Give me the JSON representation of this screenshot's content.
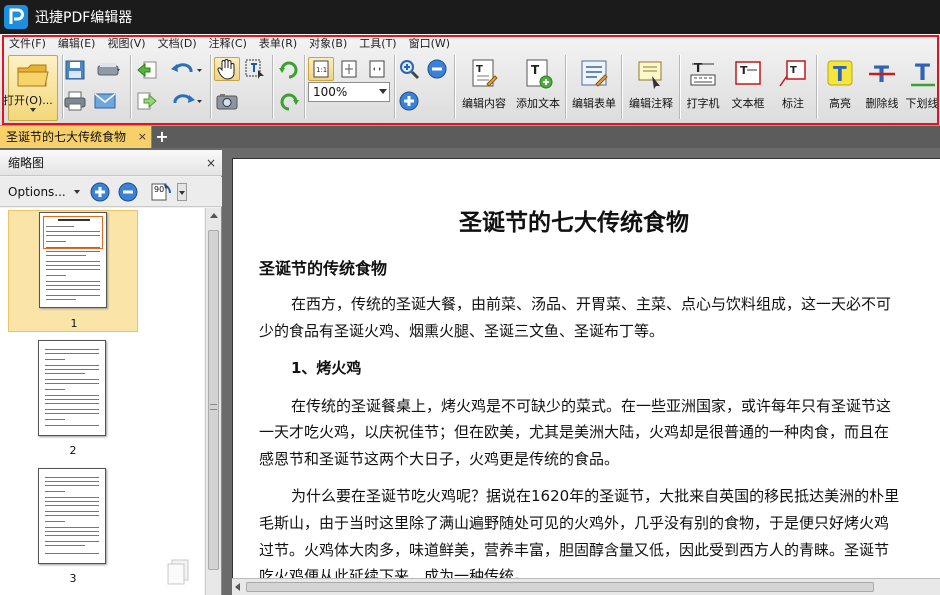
{
  "app": {
    "title": "迅捷PDF编辑器"
  },
  "menu": [
    "文件(F)",
    "编辑(E)",
    "视图(V)",
    "文档(D)",
    "注释(C)",
    "表单(R)",
    "对象(B)",
    "工具(T)",
    "窗口(W)"
  ],
  "toolbar": {
    "open_label": "打开(O)...",
    "zoom_value": "100%",
    "edit_content": "编辑内容",
    "add_text": "添加文本",
    "edit_form": "编辑表单",
    "edit_annotation": "编辑注释",
    "typewriter": "打字机",
    "textbox": "文本框",
    "callout": "标注",
    "highlight": "高亮",
    "strikethrough": "删除线",
    "underline": "下划线"
  },
  "tabs": {
    "doc_tab": "圣诞节的七大传统食物",
    "close": "×",
    "add": "+"
  },
  "left_panel": {
    "title": "缩略图",
    "close": "×",
    "options_label": "Options...",
    "rotate_label": "90°",
    "pages": [
      "1",
      "2",
      "3"
    ]
  },
  "document": {
    "title": "圣诞节的七大传统食物",
    "heading1": "圣诞节的传统食物",
    "p1_l1": "在西方，传统的圣诞大餐，由前菜、汤品、开胃菜、主菜、点心与饮料组成，这一天必不可",
    "p1_l2": "少的食品有圣诞火鸡、烟熏火腿、圣诞三文鱼、圣诞布丁等。",
    "heading2": "1、烤火鸡",
    "p2_l1": "在传统的圣诞餐桌上，烤火鸡是不可缺少的菜式。在一些亚洲国家，或许每年只有圣诞节这",
    "p2_l2": "一天才吃火鸡，以庆祝佳节；但在欧美，尤其是美洲大陆，火鸡却是很普通的一种肉食，而且在",
    "p2_l3": "感恩节和圣诞节这两个大日子，火鸡更是传统的食品。",
    "p3_l1": "为什么要在圣诞节吃火鸡呢？据说在1620年的圣诞节，大批来自英国的移民抵达美洲的朴里",
    "p3_l2": "毛斯山，由于当时这里除了满山遍野随处可见的火鸡外，几乎没有别的食物，于是便只好烤火鸡",
    "p3_l3": "过节。火鸡体大肉多，味道鲜美，营养丰富，胆固醇含量又低，因此受到西方人的青睐。圣诞节",
    "p3_l4": "吃火鸡便从此延续下来，成为一种传统。"
  },
  "colors": {
    "accent_red": "#e0141f",
    "tab_yellow": "#f7d06a"
  }
}
